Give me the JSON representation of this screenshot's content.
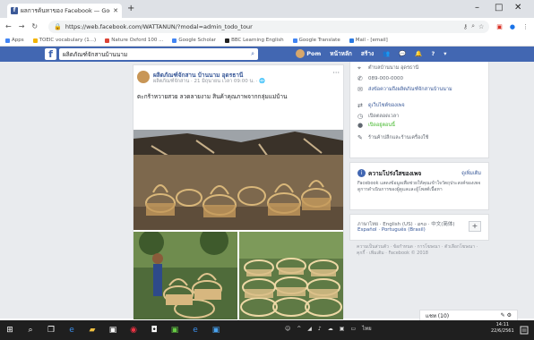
{
  "browser": {
    "tab_title": "ผลการค้นหาของ Facebook — Google",
    "url": "https://web.facebook.com/WATTANUN/?modal=admin_todo_tour",
    "bookmarks": [
      {
        "label": "Apps",
        "color": "#4285f4"
      },
      {
        "label": "TOEIC vocabulary (1...)",
        "color": "#f4b400"
      },
      {
        "label": "Nature Oxford 100 ...",
        "color": "#db4437"
      },
      {
        "label": "Google Scholar",
        "color": "#4285f4"
      },
      {
        "label": "BBC Learning English",
        "color": "#222222"
      },
      {
        "label": "Google Translate",
        "color": "#4285f4"
      },
      {
        "label": "Mail - [email]",
        "color": "#2a7ae2"
      }
    ]
  },
  "facebook": {
    "search_value": "ผลิตภัณฑ์จักสานบ้านนาม",
    "nav": {
      "profile_name": "Pom",
      "home": "หน้าหลัก",
      "create": "สร้าง"
    }
  },
  "post": {
    "page_name": "ผลิตภัณฑ์จักสาน บ้านนาม อุดรธานี",
    "meta": "ผลิตภัณฑ์จักสาน · 21 มิถุนายน เวลา 09:00 น. · 🌐",
    "text": "ตะกร้าหวายสวย ลวดลายงาม สินค้าคุณภาพจากกลุ่มแม่บ้าน"
  },
  "about": {
    "rows": [
      {
        "icon": "location-icon",
        "text": "ตำบลบ้านนาม อุดรธานี",
        "style": "plain"
      },
      {
        "icon": "phone-icon",
        "text": "089-000-0000",
        "style": "plain"
      },
      {
        "icon": "messenger-icon",
        "text": "ส่งข้อความถึงผลิตภัณฑ์จักสานบ้านนาม",
        "style": "link"
      },
      {
        "icon": "web-icon",
        "text": "ดูเว็บไซต์ของเพจ",
        "style": "link"
      },
      {
        "icon": "clock-icon",
        "text": "เปิดตลอดเวลา",
        "style": "plain"
      },
      {
        "icon": "status-icon",
        "text": "เปิดอยู่ตอนนี้",
        "style": "green"
      },
      {
        "icon": "tag-icon",
        "text": "ร้านค้าปลีกและร้านเครื่องใช้",
        "style": "plain"
      }
    ]
  },
  "transparency": {
    "title": "ความโปร่งใสของเพจ",
    "link": "ดูเพิ่มเติม",
    "body": "Facebook แสดงข้อมูลเพื่อช่วยให้คุณเข้าใจวัตถุประสงค์ของเพจ ดูการดำเนินการของผู้ดูแลและผู้โพสต์เนื้อหา"
  },
  "language": {
    "line1": "ภาษาไทย · English (US) · ລາວ · 中文(简体)",
    "line2": "Español · Português (Brasil)",
    "plus": "+"
  },
  "footer": {
    "text": "ความเป็นส่วนตัว · ข้อกำหนด · การโฆษณา · ตัวเลือกโฆษณา · คุกกี้ · เพิ่มเติม · Facebook © 2018"
  },
  "chat": {
    "label": "แชท (10)",
    "icons": "✎ ⚙"
  },
  "taskbar": {
    "clock_time": "14:11",
    "clock_date": "22/6/2561"
  }
}
